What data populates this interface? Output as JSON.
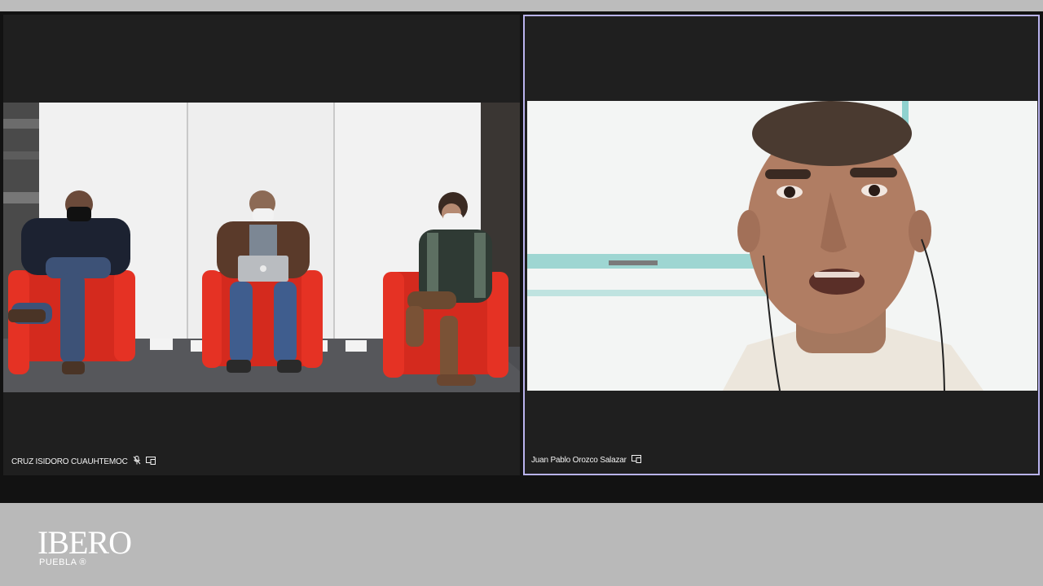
{
  "participants": [
    {
      "name": "CRUZ ISIDORO CUAUHTEMOC",
      "mic_icon": "mic-muted-icon",
      "share_icon": "screen-share-icon"
    },
    {
      "name": "Juan Pablo Orozco Salazar",
      "share_icon": "screen-share-icon",
      "active_speaker": true
    }
  ],
  "branding": {
    "logo_text": "IBERO",
    "logo_subtext": "PUEBLA ®"
  },
  "colors": {
    "active_speaker_border": "#b9b3ee",
    "tile_background": "#1f1f1f",
    "footer_background": "#b9b9b9"
  }
}
